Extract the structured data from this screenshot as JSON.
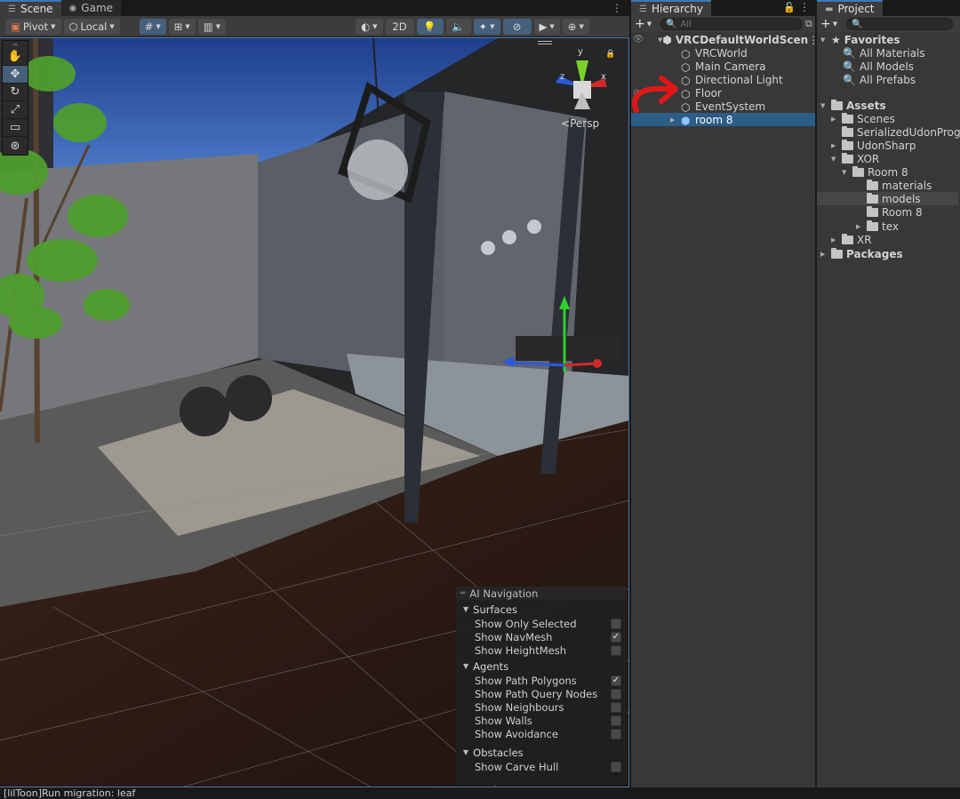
{
  "scene_tabs": {
    "scene": "Scene",
    "game": "Game"
  },
  "toolbar": {
    "pivot": "Pivot",
    "local": "Local",
    "mode_2d": "2D"
  },
  "scene_view": {
    "persp_label": "Persp",
    "gizmo_axes": {
      "x": "x",
      "y": "y",
      "z": "z"
    }
  },
  "ai_navigation": {
    "title": "AI Navigation",
    "surfaces": {
      "label": "Surfaces",
      "items": [
        {
          "label": "Show Only Selected",
          "checked": false
        },
        {
          "label": "Show NavMesh",
          "checked": true
        },
        {
          "label": "Show HeightMesh",
          "checked": false
        }
      ]
    },
    "agents": {
      "label": "Agents",
      "items": [
        {
          "label": "Show Path Polygons",
          "checked": true
        },
        {
          "label": "Show Path Query Nodes",
          "checked": false
        },
        {
          "label": "Show Neighbours",
          "checked": false
        },
        {
          "label": "Show Walls",
          "checked": false
        },
        {
          "label": "Show Avoidance",
          "checked": false
        }
      ]
    },
    "obstacles": {
      "label": "Obstacles",
      "items": [
        {
          "label": "Show Carve Hull",
          "checked": false
        }
      ]
    }
  },
  "hierarchy": {
    "tab": "Hierarchy",
    "search_placeholder": "All",
    "scene_name": "VRCDefaultWorldScen",
    "items": [
      "VRCWorld",
      "Main Camera",
      "Directional Light",
      "Floor",
      "EventSystem",
      "room 8"
    ],
    "selected": "room 8"
  },
  "project": {
    "tab": "Project",
    "favorites": {
      "label": "Favorites",
      "items": [
        "All Materials",
        "All Models",
        "All Prefabs"
      ]
    },
    "assets": {
      "label": "Assets",
      "scenes": "Scenes",
      "serialized": "SerializedUdonProgra",
      "udonsharp": "UdonSharp",
      "xor": "XOR",
      "room8": "Room 8",
      "room8_children": [
        "materials",
        "models",
        "Room 8",
        "tex"
      ],
      "xr": "XR"
    },
    "packages": "Packages",
    "selected": "models"
  },
  "status_bar": {
    "message": "[lilToon]Run migration: leaf"
  },
  "colors": {
    "accent": "#3a79bb",
    "selection": "#2c5d87",
    "panel": "#383838"
  }
}
